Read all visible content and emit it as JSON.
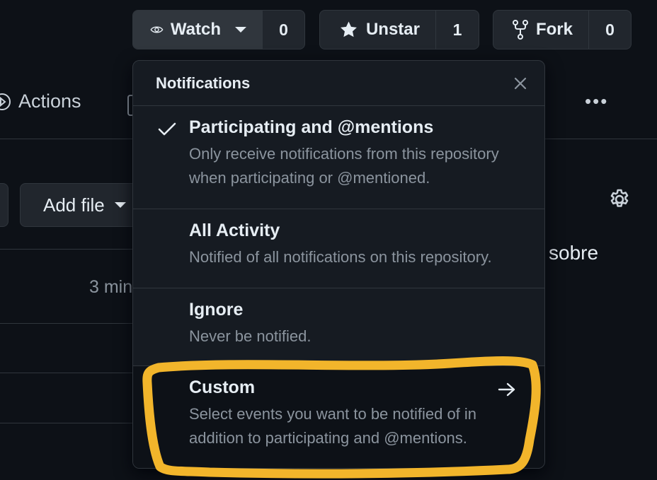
{
  "header_buttons": {
    "watch": {
      "label": "Watch",
      "count": "0",
      "icon": "eye-icon"
    },
    "star": {
      "label": "Unstar",
      "count": "1",
      "icon": "star-icon"
    },
    "fork": {
      "label": "Fork",
      "count": "0",
      "icon": "fork-icon"
    }
  },
  "repo_nav": {
    "actions_label": "Actions",
    "more": "•••"
  },
  "toolbar": {
    "add_file": "Add file"
  },
  "background_text": {
    "about_fragment": "sobre",
    "commit_time_fragment": "3 min"
  },
  "notifications_menu": {
    "title": "Notifications",
    "selected": "participating",
    "items": [
      {
        "id": "participating",
        "title": "Participating and @mentions",
        "description_line1": "Only receive notifications from this repository",
        "description_line2": "when participating or @mentioned."
      },
      {
        "id": "all",
        "title": "All Activity",
        "description_line1": "Notified of all notifications on this repository."
      },
      {
        "id": "ignore",
        "title": "Ignore",
        "description_line1": "Never be notified."
      },
      {
        "id": "custom",
        "title": "Custom",
        "description_line1": "Select events you want to be notified of in",
        "description_line2": "addition to participating and @mentions."
      }
    ]
  },
  "colors": {
    "background": "#0d1117",
    "menu_bg": "#161b22",
    "border": "#30363d",
    "highlight": "#f2b52b",
    "muted_text": "#8b949e"
  }
}
